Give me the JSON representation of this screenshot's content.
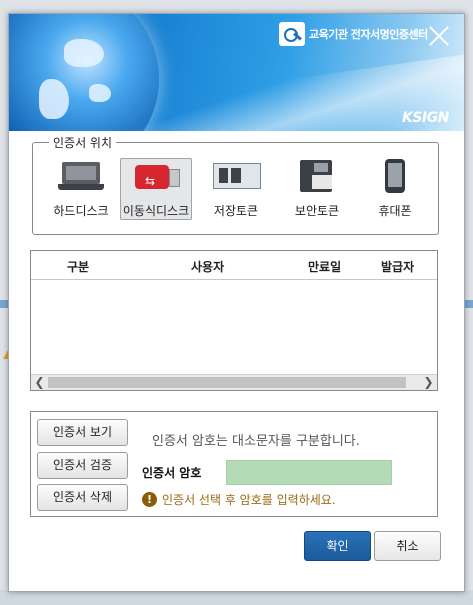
{
  "header": {
    "brand_text": "교육기관 전자서명인증센터",
    "vendor_logo": "KSIGN"
  },
  "location": {
    "legend": "인증서 위치",
    "selected": "이동식디스크",
    "items": [
      {
        "label": "하드디스크",
        "icon": "hard-disk-icon"
      },
      {
        "label": "이동식디스크",
        "icon": "usb-drive-icon"
      },
      {
        "label": "저장토큰",
        "icon": "storage-token-icon"
      },
      {
        "label": "보안토큰",
        "icon": "security-token-icon"
      },
      {
        "label": "휴대폰",
        "icon": "mobile-phone-icon"
      }
    ]
  },
  "table": {
    "columns": [
      "구분",
      "사용자",
      "만료일",
      "발급자"
    ],
    "rows": []
  },
  "actions": {
    "view": "인증서 보기",
    "verify": "인증서 검증",
    "delete": "인증서 삭제"
  },
  "password": {
    "notice": "인증서 암호는 대소문자를 구분합니다.",
    "label": "인증서 암호",
    "value": "",
    "warning": "인증서 선택 후 암호를 입력하세요."
  },
  "footer": {
    "ok": "확인",
    "cancel": "취소"
  },
  "colors": {
    "primary_button": "#1f64a8",
    "password_field": "#b3dbb5",
    "warning_text": "#9a6a12"
  }
}
